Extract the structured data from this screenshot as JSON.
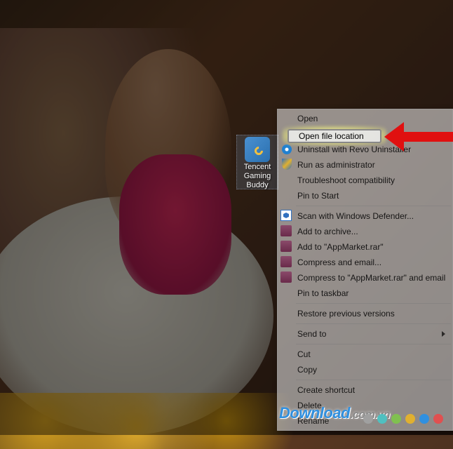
{
  "desktop_icon": {
    "label_line1": "Tencent",
    "label_line2": "Gaming",
    "label_line3": "Buddy"
  },
  "context_menu": {
    "open": "Open",
    "open_file_location": "Open file location",
    "uninstall_revo": "Uninstall with Revo Uninstaller",
    "run_as_admin": "Run as administrator",
    "troubleshoot": "Troubleshoot compatibility",
    "pin_start": "Pin to Start",
    "scan_defender": "Scan with Windows Defender...",
    "add_archive": "Add to archive...",
    "add_appmarket": "Add to \"AppMarket.rar\"",
    "compress_email": "Compress and email...",
    "compress_appmarket_email": "Compress to \"AppMarket.rar\" and email",
    "pin_taskbar": "Pin to taskbar",
    "restore_versions": "Restore previous versions",
    "send_to": "Send to",
    "cut": "Cut",
    "copy": "Copy",
    "create_shortcut": "Create shortcut",
    "delete": "Delete",
    "rename": "Rename"
  },
  "watermark": {
    "brand": "Download",
    "domain": ".com.vn"
  },
  "dot_colors": [
    "#a0a0a0",
    "#50c0c0",
    "#80c050",
    "#e0b030",
    "#3090e0",
    "#e05050"
  ]
}
